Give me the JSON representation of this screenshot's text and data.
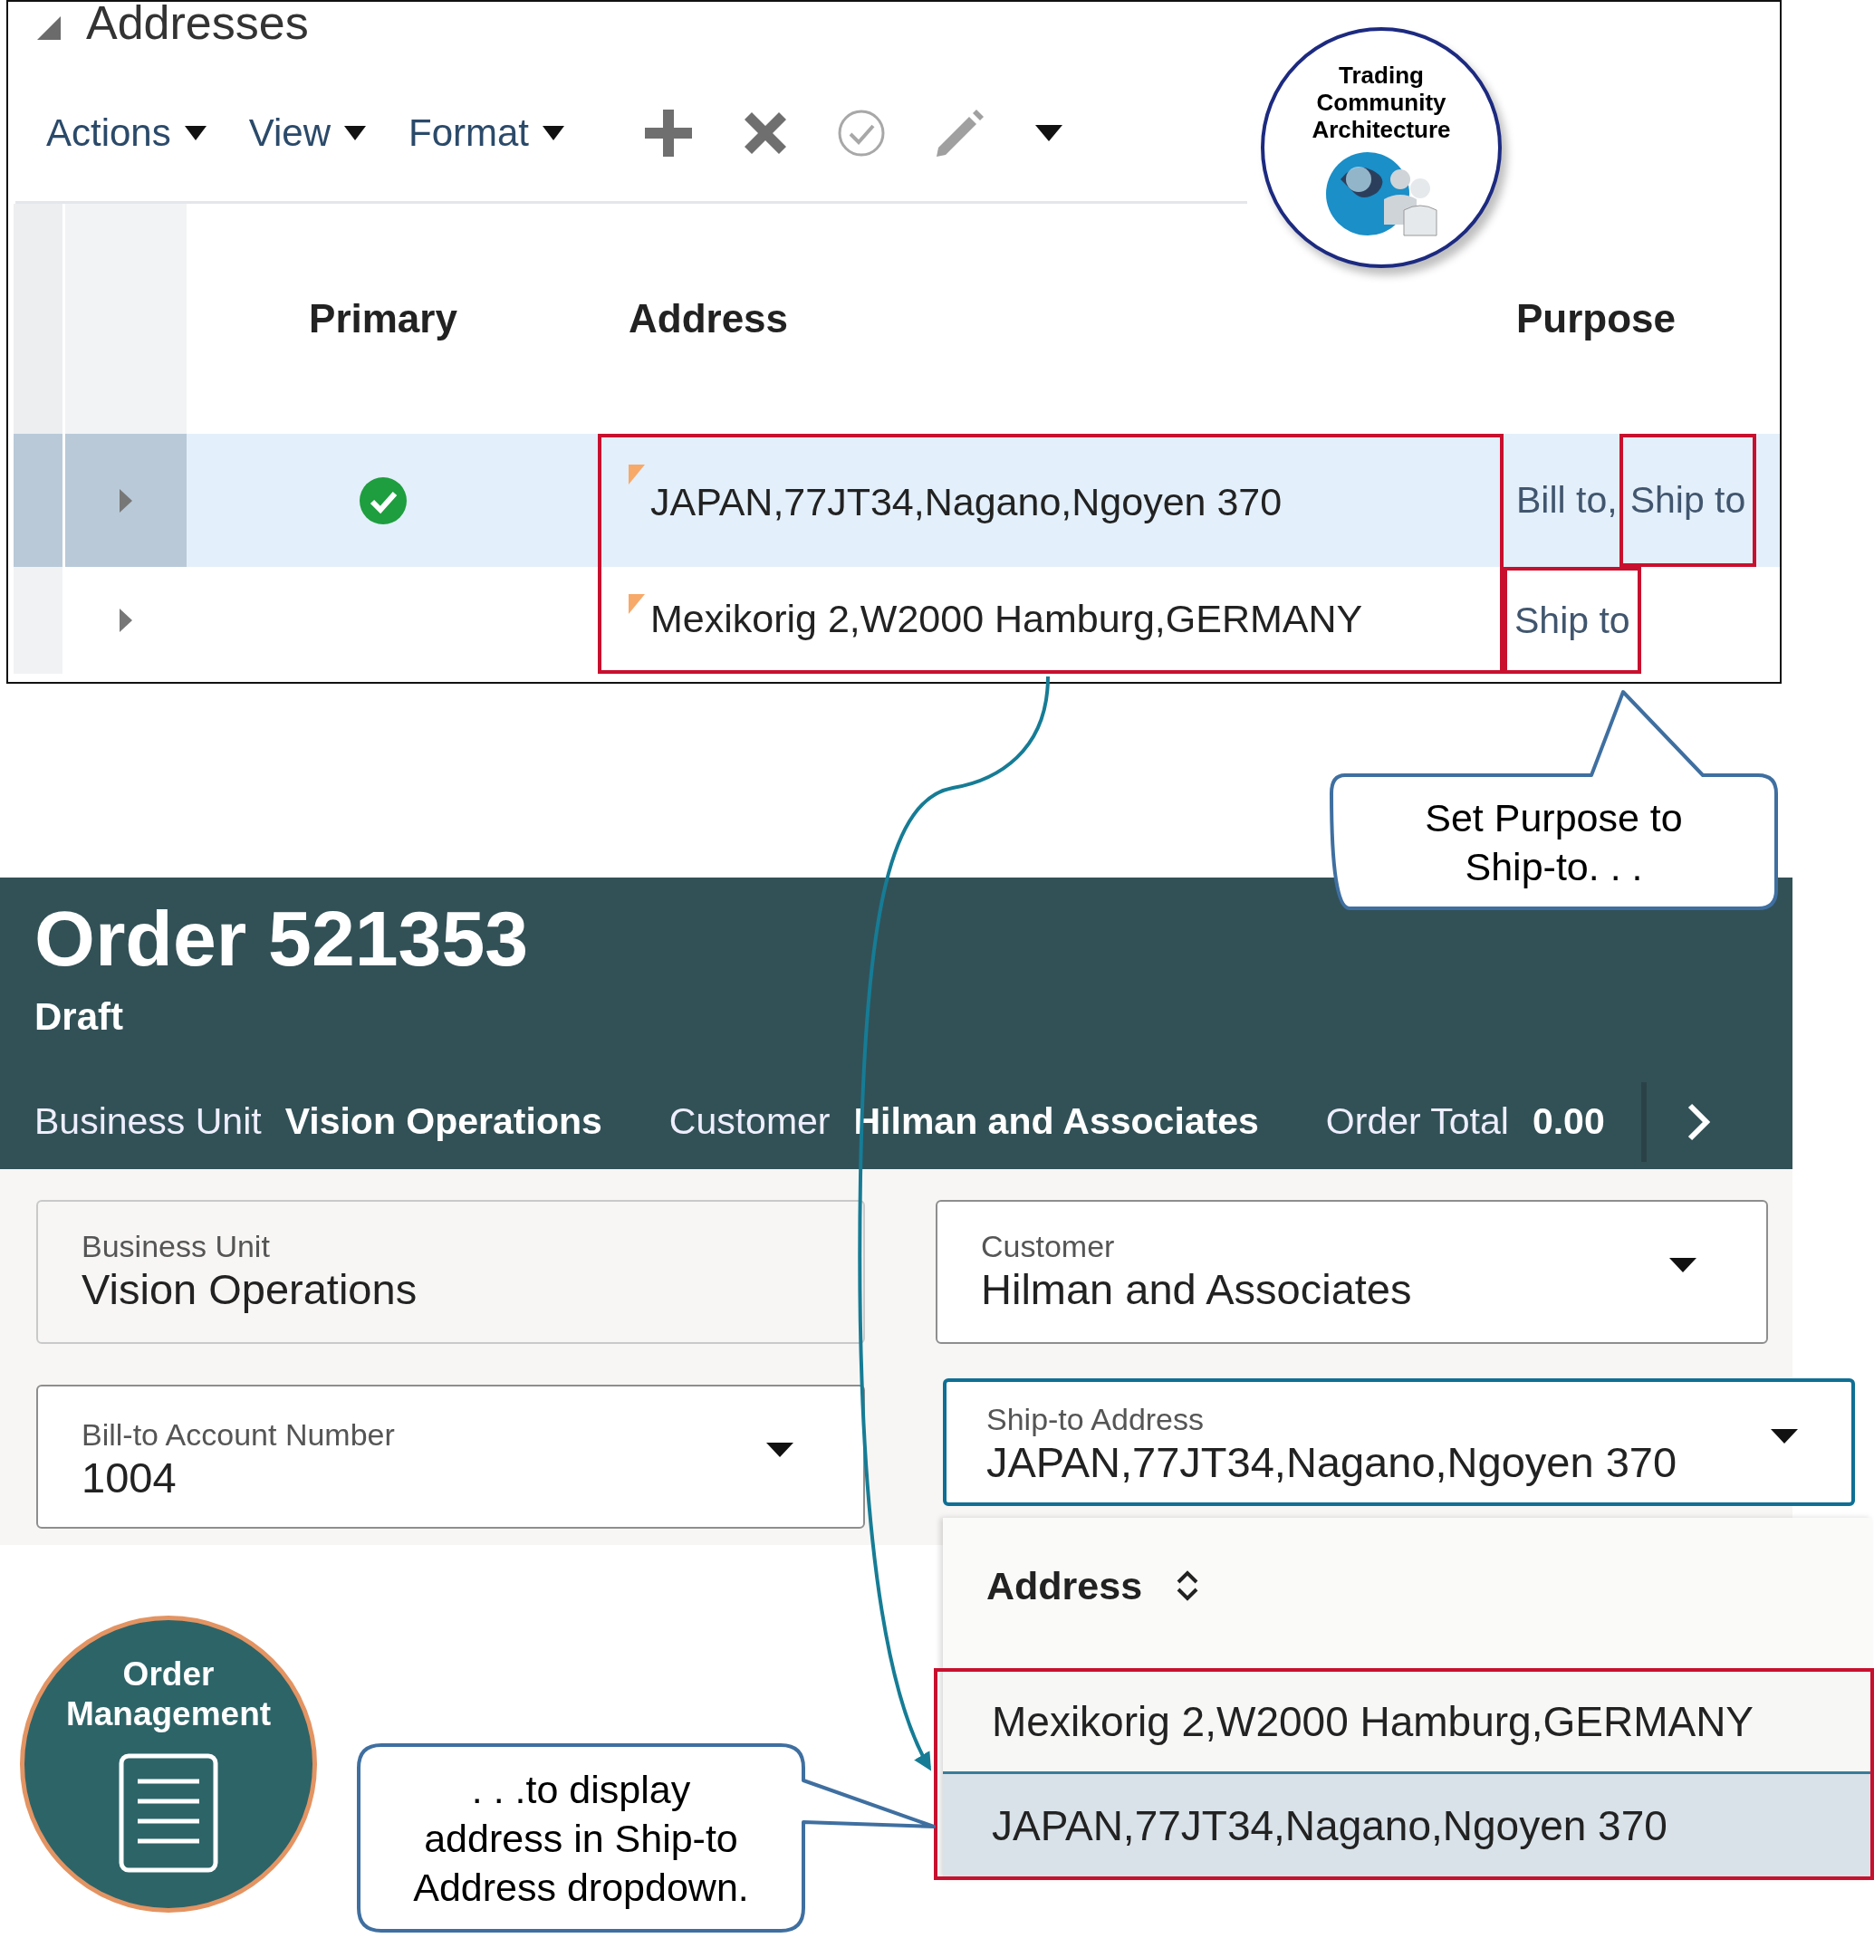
{
  "addresses_panel": {
    "title": "Addresses",
    "expanded": true,
    "toolbar": [
      {
        "label": "Actions"
      },
      {
        "label": "View"
      },
      {
        "label": "Format"
      }
    ],
    "columns": [
      "Primary",
      "Address",
      "Purpose"
    ],
    "rows": [
      {
        "selected": true,
        "primary": true,
        "address": "JAPAN,77JT34,Nagano,Ngoyen 370",
        "address_highlighted": true,
        "purposes": [
          {
            "label": "Bill to,",
            "highlighted": false
          },
          {
            "label": "Ship to",
            "highlighted": true
          }
        ]
      },
      {
        "selected": false,
        "primary": false,
        "address": "Mexikorig 2,W2000 Hamburg,GERMANY",
        "address_highlighted": true,
        "purposes": [
          {
            "label": "Ship to",
            "highlighted": true
          }
        ]
      }
    ]
  },
  "tca_badge": {
    "label": "Trading\nCommunity\nArchitecture"
  },
  "order_header": {
    "title": "Order 521353",
    "status": "Draft",
    "info": [
      {
        "label": "Business Unit",
        "value": "Vision Operations"
      },
      {
        "label": "Customer",
        "value": "Hilman and Associates"
      },
      {
        "label": "Order Total",
        "value": "0.00"
      }
    ]
  },
  "fields": [
    {
      "label": "Business Unit",
      "value": "Vision Operations",
      "kind": "readonly",
      "focused": false
    },
    {
      "label": "Customer",
      "value": "Hilman and Associates",
      "kind": "select",
      "focused": false
    },
    {
      "label": "Bill-to Account Number",
      "value": "1004",
      "kind": "select",
      "focused": false
    },
    {
      "label": "Ship-to Address",
      "value": "JAPAN,77JT34,Nagano,Ngoyen 370",
      "kind": "select",
      "focused": true
    }
  ],
  "ship_to_dropdown": {
    "column": "Address",
    "options_highlighted": true,
    "options": [
      {
        "label": "Mexikorig 2,W2000 Hamburg,GERMANY",
        "selected": false
      },
      {
        "label": "JAPAN,77JT34,Nagano,Ngoyen 370",
        "selected": true
      }
    ]
  },
  "om_badge": {
    "label": "Order\nManagement"
  },
  "callouts": [
    {
      "text": "Set Purpose to\nShip-to. . ."
    },
    {
      "text": ". . .to display\naddress in Ship-to\nAddress dropdown."
    }
  ]
}
